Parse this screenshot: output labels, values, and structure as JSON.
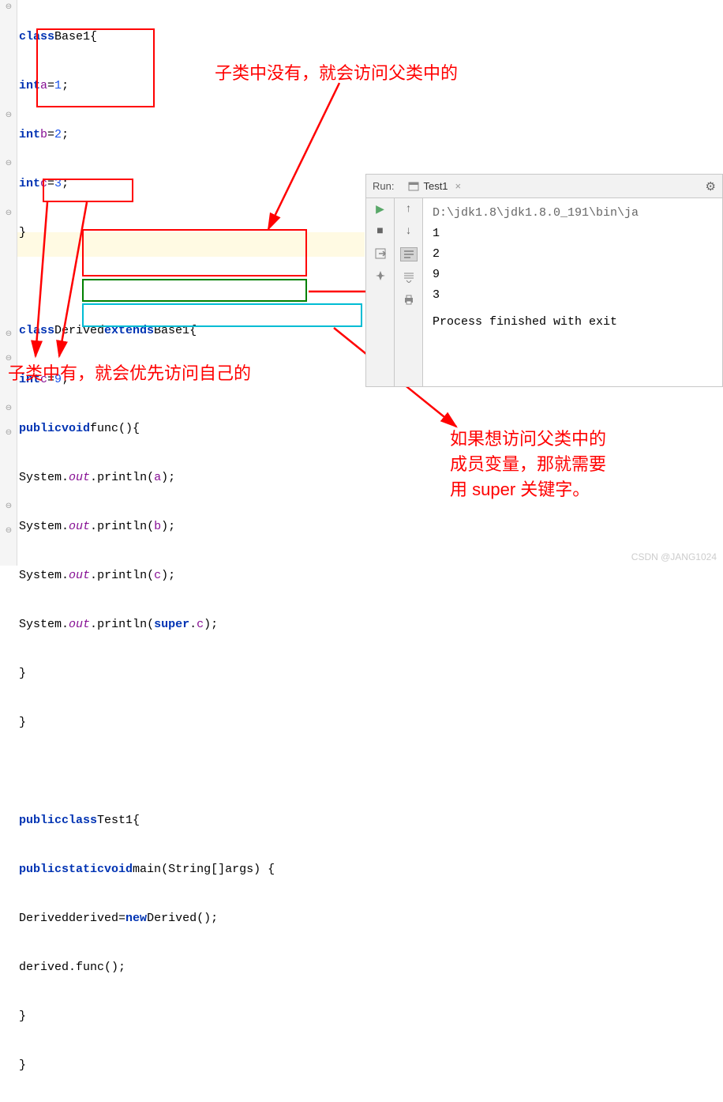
{
  "code": {
    "l1": {
      "kw1": "class",
      "name": "Base1",
      "brace": "{"
    },
    "l2": {
      "kw": "int",
      "v": "a",
      "eq": "=",
      "n": "1",
      ";": ";"
    },
    "l3": {
      "kw": "int",
      "v": "b",
      "eq": "=",
      "n": "2",
      ";": ";"
    },
    "l4": {
      "kw": "int",
      "v": "c",
      "eq": "=",
      "n": "3",
      ";": ";"
    },
    "l5": {
      "brace": "}"
    },
    "l7": {
      "kw1": "class",
      "name": "Derived",
      "kw2": "extends",
      "base": "Base1",
      "brace": "{"
    },
    "l8": {
      "kw": "int",
      "v": "c",
      "eq": "=",
      "n": "9",
      ";": ";"
    },
    "l9": {
      "kw1": "public",
      "kw2": "void",
      "name": "func",
      "p": "(){"
    },
    "l10": {
      "sys": "System",
      "dot1": ".",
      "out": "out",
      "dot2": ".",
      "m": "println",
      "p1": "(",
      "arg": "a",
      "p2": ");"
    },
    "l11": {
      "sys": "System",
      "dot1": ".",
      "out": "out",
      "dot2": ".",
      "m": "println",
      "p1": "(",
      "arg": "b",
      "p2": ");"
    },
    "l12": {
      "sys": "System",
      "dot1": ".",
      "out": "out",
      "dot2": ".",
      "m": "println",
      "p1": "(",
      "arg": "c",
      "p2": ");"
    },
    "l13": {
      "sys": "System",
      "dot1": ".",
      "out": "out",
      "dot2": ".",
      "m": "println",
      "p1": "(",
      "kw": "super",
      "dot3": ".",
      "arg": "c",
      "p2": ");"
    },
    "l14": {
      "brace": "}"
    },
    "l15": {
      "brace": "}"
    },
    "l17": {
      "kw1": "public",
      "kw2": "class",
      "name": "Test1",
      "brace": "{"
    },
    "l18": {
      "kw1": "public",
      "kw2": "static",
      "kw3": "void",
      "name": "main",
      "p1": "(",
      "t": "String",
      "arr": "[]",
      "arg": "args",
      "p2": ") {"
    },
    "l19": {
      "t": "Derived",
      "v": "derived",
      "eq": "=",
      "kw": "new",
      "t2": "Derived",
      "p": "();"
    },
    "l20": {
      "v": "derived",
      "dot": ".",
      "m": "func",
      "p": "();"
    },
    "l21": {
      "brace": "}"
    },
    "l22": {
      "brace": "}"
    }
  },
  "anno": {
    "top": "子类中没有，就会访问父类中的",
    "left": "子类中有，就会优先访问自己的",
    "right_l1": "如果想访问父类中的",
    "right_l2": "成员变量，那就需要",
    "right_l3": "用 super 关键字。"
  },
  "run": {
    "label": "Run:",
    "tab": "Test1",
    "path": "D:\\jdk1.8\\jdk1.8.0_191\\bin\\ja",
    "out1": "1",
    "out2": "2",
    "out3": "9",
    "out4": "3",
    "process": "Process finished with exit"
  },
  "watermark": "CSDN @JANG1024"
}
